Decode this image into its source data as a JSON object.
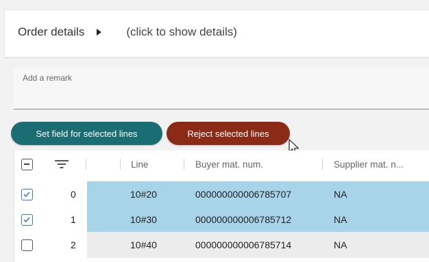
{
  "order": {
    "title": "Order details",
    "hint": "(click to show details)"
  },
  "remark": {
    "placeholder": "Add a remark",
    "value": ""
  },
  "actions": {
    "set_field_label": "Set field for selected lines",
    "reject_label": "Reject selected lines"
  },
  "colors": {
    "set_field_button": "#1a6d73",
    "reject_button": "#8b2b17",
    "selected_row": "#a8d4ea",
    "checkbox_checked": "#3a78c6"
  },
  "table": {
    "columns": [
      "Line",
      "Buyer mat. num.",
      "Supplier mat. n..."
    ],
    "header_icons": [
      "select-all-checkbox",
      "filter-icon"
    ],
    "rows": [
      {
        "index": "0",
        "line": "10#20",
        "buyer_mat": "000000000006785707",
        "supplier_mat": "NA",
        "selected": true
      },
      {
        "index": "1",
        "line": "10#30",
        "buyer_mat": "000000000006785712",
        "supplier_mat": "NA",
        "selected": true
      },
      {
        "index": "2",
        "line": "10#40",
        "buyer_mat": "000000000006785714",
        "supplier_mat": "NA",
        "selected": false
      }
    ]
  }
}
